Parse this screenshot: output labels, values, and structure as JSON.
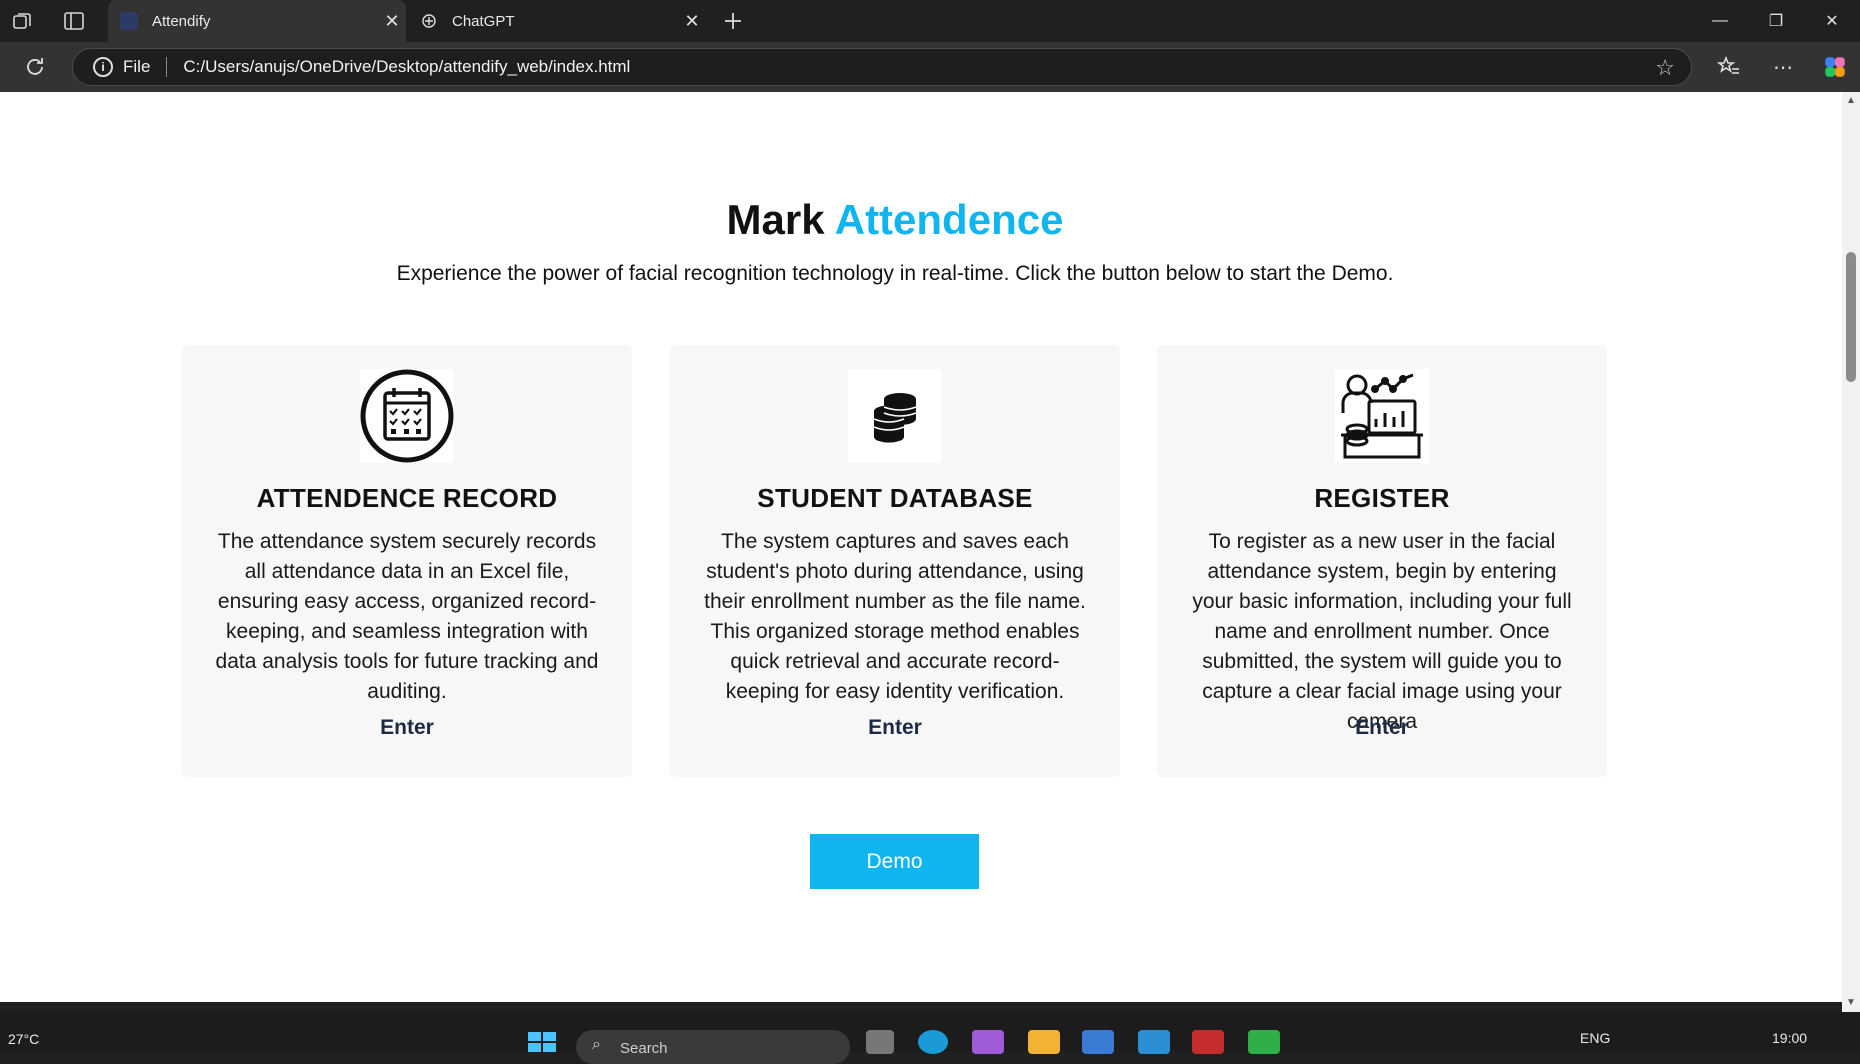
{
  "browser": {
    "tabs": [
      {
        "label": "Attendify",
        "active": true
      },
      {
        "label": "ChatGPT",
        "active": false
      }
    ],
    "address_scheme": "File",
    "address_url": "C:/Users/anujs/OneDrive/Desktop/attendify_web/index.html"
  },
  "page": {
    "heading_main": "Mark",
    "heading_accent": "Attendence",
    "subtitle": "Experience the power of facial recognition technology in real-time. Click the button below to start the Demo.",
    "cards": [
      {
        "icon": "calendar-checklist-icon",
        "title": "ATTENDENCE RECORD",
        "text": "The attendance system securely records all attendance data in an Excel file, ensuring easy access, organized record-keeping, and seamless integration with data analysis tools for future tracking and auditing.",
        "link": "Enter"
      },
      {
        "icon": "database-stack-icon",
        "title": "STUDENT DATABASE",
        "text": "The system captures and saves each student's photo during attendance, using their enrollment number as the file name. This organized storage method enables quick retrieval and accurate record-keeping for easy identity verification.",
        "link": "Enter"
      },
      {
        "icon": "user-analytics-icon",
        "title": "REGISTER",
        "text": "To register as a new user in the facial attendance system, begin by entering your basic information, including your full name and enrollment number. Once submitted, the system will guide you to capture a clear facial image using your camera",
        "link": "Enter"
      }
    ],
    "demo_button": "Demo"
  },
  "taskbar": {
    "temperature": "27°C",
    "search_placeholder": "Search",
    "language": "ENG",
    "time": "19:00"
  },
  "colors": {
    "accent": "#0fb5ee",
    "card_bg": "#f7f7f7",
    "footer": "#0e2240"
  }
}
